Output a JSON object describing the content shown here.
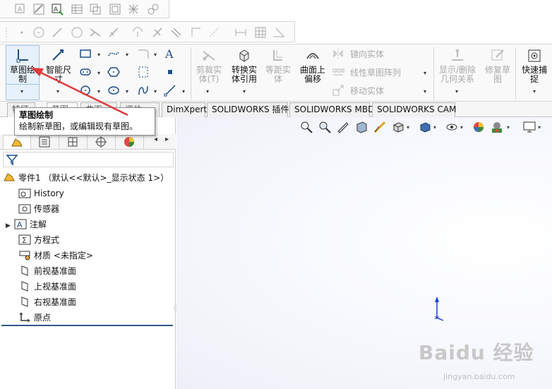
{
  "ribbon": {
    "sketch_label": "草图绘\n制",
    "smart_dim_label": "智能尺\n寸",
    "trim_label": "剪裁实\n体(T)",
    "convert_label": "转换实\n体引用",
    "offset_label": "等距实\n体",
    "surface_offset_label": "曲面上\n偏移",
    "mirror_label": "镜向实体",
    "linear_pattern_label": "线性草图阵列",
    "move_label": "移动实体",
    "show_delete_label": "显示/删除\n几何关系",
    "repair_label": "修复草\n图",
    "quick_snap_label": "快速捕\n捉"
  },
  "tabs": [
    {
      "label": "特征"
    },
    {
      "label": "草图"
    },
    {
      "label": "曲面"
    },
    {
      "label": "评估"
    },
    {
      "label": "DimXpert"
    },
    {
      "label": "SOLIDWORKS 插件"
    },
    {
      "label": "SOLIDWORKS MBD"
    },
    {
      "label": "SOLIDWORKS CAM"
    }
  ],
  "tooltip": {
    "title": "草图绘制",
    "description": "绘制新草图，或编辑现有草图。"
  },
  "tree": {
    "root": "零件1 （默认<<默认>_显示状态 1>）",
    "items": [
      {
        "label": "History"
      },
      {
        "label": "传感器"
      },
      {
        "label": "注解"
      },
      {
        "label": "方程式"
      },
      {
        "label": "材质 <未指定>"
      },
      {
        "label": "前视基准面"
      },
      {
        "label": "上视基准面"
      },
      {
        "label": "右视基准面"
      },
      {
        "label": "原点"
      }
    ]
  },
  "watermark": {
    "brand": "Baidu 经验",
    "url": "jingyan.baidu.com"
  },
  "icons": [
    "sketch-icon",
    "smart-dimension-icon",
    "rectangle-icon",
    "slot-icon",
    "circle-icon",
    "arc-icon",
    "polygon-icon",
    "spline-icon",
    "line-icon",
    "text-icon",
    "point-icon",
    "trim-icon",
    "convert-icon",
    "offset-icon",
    "surface-offset-icon",
    "mirror-icon",
    "pattern-icon",
    "move-icon",
    "relations-icon",
    "repair-icon",
    "snap-icon",
    "filter-icon",
    "part-icon",
    "folder-icon",
    "plane-icon",
    "origin-icon",
    "zoom-fit-icon",
    "zoom-area-icon",
    "prev-view-icon",
    "section-icon",
    "view-orient-icon",
    "display-style-icon",
    "hide-show-icon",
    "appearance-icon",
    "scene-icon",
    "monitor-icon",
    "triad-icon"
  ],
  "colors": {
    "accent": "#1a5ea8",
    "tooltip_arrow": "#e03a3a",
    "highlight": "#e7f1fb"
  }
}
